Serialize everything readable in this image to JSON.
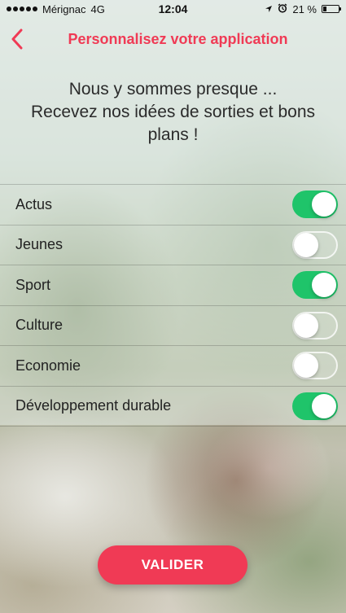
{
  "status_bar": {
    "carrier": "Mérignac",
    "network": "4G",
    "time": "12:04",
    "battery_text": "21 %",
    "battery_level": 0.21
  },
  "header": {
    "title": "Personnalisez votre application",
    "back_icon": "chevron-left-icon"
  },
  "intro": {
    "line1": "Nous y sommes presque ...",
    "line2": "Recevez nos idées de sorties et bons plans !"
  },
  "categories": [
    {
      "label": "Actus",
      "enabled": true
    },
    {
      "label": "Jeunes",
      "enabled": false
    },
    {
      "label": "Sport",
      "enabled": true
    },
    {
      "label": "Culture",
      "enabled": false
    },
    {
      "label": "Economie",
      "enabled": false
    },
    {
      "label": "Développement durable",
      "enabled": true
    }
  ],
  "validate_button": {
    "label": "VALIDER"
  },
  "colors": {
    "accent": "#f03a55",
    "toggle_on": "#1fc46a"
  }
}
